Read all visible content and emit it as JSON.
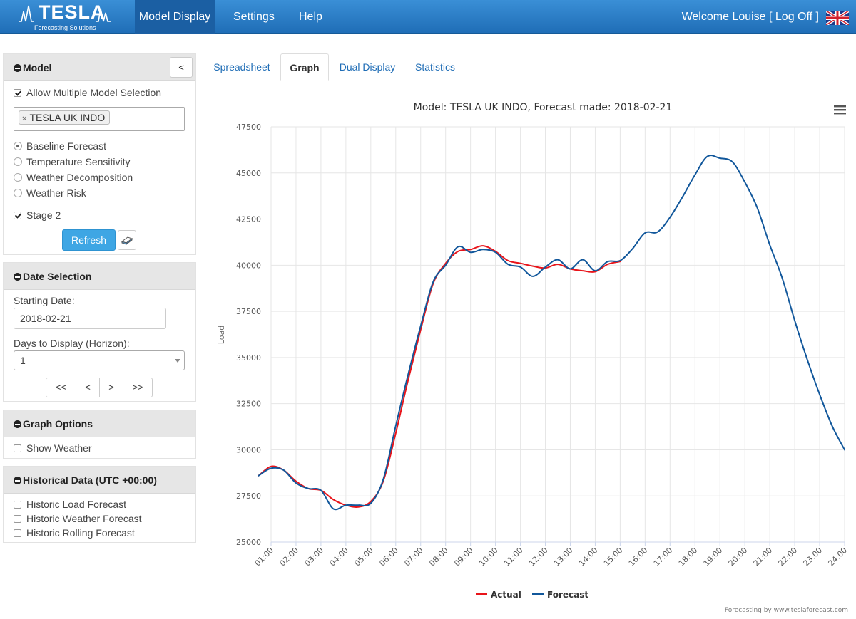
{
  "navbar": {
    "logo_text": "TESLA",
    "logo_sub": "Forecasting Solutions",
    "items": [
      {
        "label": "Model Display",
        "active": true
      },
      {
        "label": "Settings",
        "active": false
      },
      {
        "label": "Help",
        "active": false
      }
    ],
    "welcome_prefix": "Welcome Louise [",
    "logoff": "Log Off",
    "welcome_suffix": "]",
    "brand_color": "#2a7fc9",
    "flag_icon": "uk-flag-icon"
  },
  "model_panel": {
    "title": "Model",
    "collapse_label": "<",
    "allow_multiple": {
      "label": "Allow Multiple Model Selection",
      "checked": true
    },
    "selected_model": "TESLA UK INDO",
    "remove_symbol": "×",
    "options": [
      {
        "label": "Baseline Forecast",
        "selected": true
      },
      {
        "label": "Temperature Sensitivity",
        "selected": false
      },
      {
        "label": "Weather Decomposition",
        "selected": false
      },
      {
        "label": "Weather Risk",
        "selected": false
      }
    ],
    "stage2": {
      "label": "Stage 2",
      "checked": true
    },
    "refresh_label": "Refresh",
    "eraser_icon": "eraser-icon"
  },
  "date_panel": {
    "title": "Date Selection",
    "starting_label": "Starting Date:",
    "starting_value": "2018-02-21",
    "days_label": "Days to Display (Horizon):",
    "days_value": "1",
    "nav": [
      "<<",
      "<",
      ">",
      ">>"
    ]
  },
  "graph_panel": {
    "title": "Graph Options",
    "show_weather": {
      "label": "Show Weather",
      "checked": false
    }
  },
  "historical_panel": {
    "title": "Historical Data (UTC +00:00)",
    "items": [
      {
        "label": "Historic Load Forecast",
        "checked": false
      },
      {
        "label": "Historic Weather Forecast",
        "checked": false
      },
      {
        "label": "Historic Rolling Forecast",
        "checked": false
      }
    ]
  },
  "tabs": [
    {
      "label": "Spreadsheet",
      "active": false
    },
    {
      "label": "Graph",
      "active": true
    },
    {
      "label": "Dual Display",
      "active": false
    },
    {
      "label": "Statistics",
      "active": false
    }
  ],
  "chart_data": {
    "type": "line",
    "title": "Model: TESLA UK INDO, Forecast made: 2018-02-21",
    "ylabel": "Load",
    "xlabel": "",
    "ylim": [
      25000,
      47500
    ],
    "yticks": [
      25000,
      27500,
      30000,
      32500,
      35000,
      37500,
      40000,
      42500,
      45000,
      47500
    ],
    "xticks": [
      "01:00",
      "02:00",
      "03:00",
      "04:00",
      "05:00",
      "06:00",
      "07:00",
      "08:00",
      "09:00",
      "10:00",
      "11:00",
      "12:00",
      "13:00",
      "14:00",
      "15:00",
      "16:00",
      "17:00",
      "18:00",
      "19:00",
      "20:00",
      "21:00",
      "22:00",
      "23:00",
      "24:00"
    ],
    "grid": true,
    "legend_position": "bottom-center",
    "menu_icon": "hamburger-menu-icon",
    "credits": "Forecasting by www.teslaforecast.com",
    "series": [
      {
        "name": "Actual",
        "color": "#e8141a",
        "x": [
          0.5,
          1,
          1.5,
          2,
          2.5,
          3,
          3.5,
          4,
          4.5,
          5,
          5.5,
          6,
          6.5,
          7,
          7.5,
          8,
          8.5,
          9,
          9.5,
          10,
          10.5,
          11,
          11.5,
          12,
          12.5,
          13,
          13.5,
          14,
          14.5,
          15
        ],
        "values": [
          28600,
          29100,
          28900,
          28300,
          27900,
          27800,
          27300,
          27000,
          26900,
          27200,
          28300,
          30900,
          33800,
          36500,
          39000,
          40100,
          40750,
          40850,
          41050,
          40750,
          40250,
          40100,
          39950,
          39850,
          40050,
          39800,
          39700,
          39650,
          40050,
          40200
        ]
      },
      {
        "name": "Forecast",
        "color": "#11579b",
        "x": [
          0.5,
          1,
          1.5,
          2,
          2.5,
          3,
          3.5,
          4,
          4.5,
          5,
          5.5,
          6,
          6.5,
          7,
          7.5,
          8,
          8.5,
          9,
          9.5,
          10,
          10.5,
          11,
          11.5,
          12,
          12.5,
          13,
          13.5,
          14,
          14.5,
          15,
          15.5,
          16,
          16.5,
          17,
          17.5,
          18,
          18.5,
          19,
          19.5,
          20,
          20.5,
          21,
          21.5,
          22,
          22.5,
          23,
          23.5,
          24
        ],
        "values": [
          28600,
          29000,
          28900,
          28200,
          27900,
          27800,
          26800,
          27000,
          27000,
          27100,
          28400,
          31300,
          34100,
          36700,
          39100,
          40000,
          41000,
          40700,
          40850,
          40700,
          40050,
          39900,
          39400,
          39900,
          40300,
          39800,
          40300,
          39700,
          40200,
          40250,
          40900,
          41750,
          41800,
          42600,
          43700,
          44900,
          45900,
          45800,
          45600,
          44500,
          43100,
          41100,
          39300,
          37000,
          34900,
          33000,
          31300,
          30000
        ]
      }
    ]
  }
}
